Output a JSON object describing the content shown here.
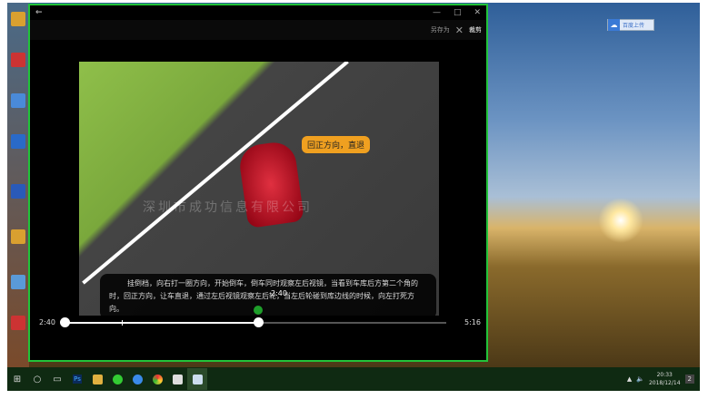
{
  "desktop": {
    "cloud_badge": "百度上传"
  },
  "window": {
    "back": "←",
    "minimize": "—",
    "maximize": "□",
    "close": "✕",
    "save_as": "另存为",
    "cancel_icon": "✕",
    "cancel": "裁剪"
  },
  "video": {
    "callout": "回正方向，直退",
    "watermark": "深圳市成功信息有限公司",
    "subtitle": "挂倒档，向右打一圈方向，开始倒车，倒车同时观察左后视镜，当看到车库后方第二个角的时，回正方向，让车直退，通过左后视镜观察左后轮，当左后轮碰到库边线的时候，向左打死方向。",
    "tooltip": "2:40"
  },
  "player": {
    "current": "2:40",
    "end": "5:16",
    "progress": 0.506,
    "marker": 0.506,
    "tick": 0.15
  },
  "taskbar": {
    "start": "⊞",
    "search": "○",
    "taskview": "▭",
    "ps": "Ps",
    "time": "20:33",
    "date": "2018/12/14",
    "notify": "2"
  }
}
